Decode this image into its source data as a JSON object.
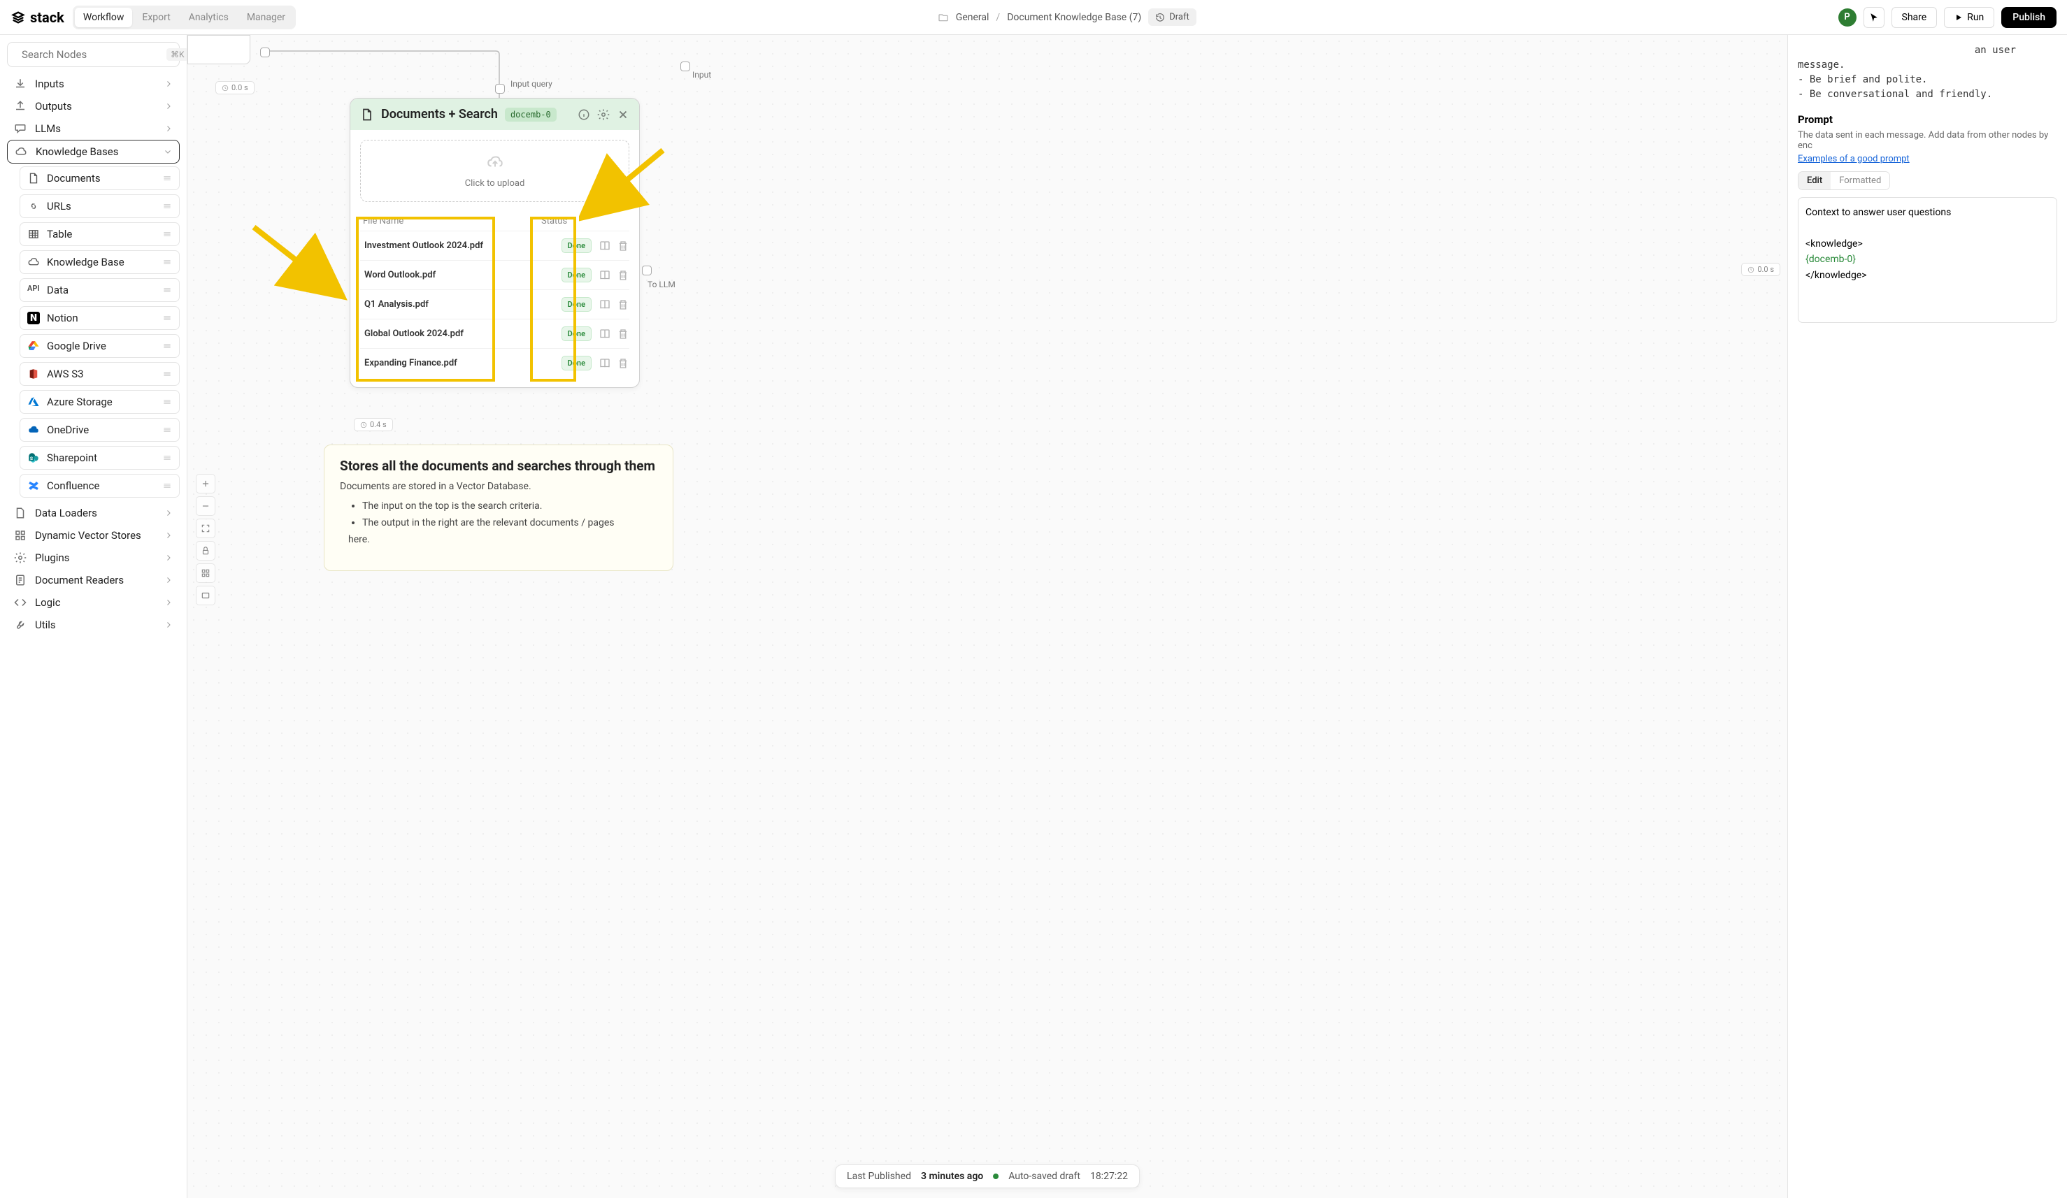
{
  "header": {
    "logo_text": "stack",
    "tabs": [
      "Workflow",
      "Export",
      "Analytics",
      "Manager"
    ],
    "active_tab": 0,
    "breadcrumb": {
      "folder": "General",
      "doc": "Document Knowledge Base (7)"
    },
    "status_badge": "Draft",
    "avatar_initial": "P",
    "share": "Share",
    "run": "Run",
    "publish": "Publish"
  },
  "sidebar": {
    "search_placeholder": "Search Nodes",
    "search_kbd": "⌘K",
    "groups": [
      {
        "label": "Inputs",
        "icon": "download"
      },
      {
        "label": "Outputs",
        "icon": "upload"
      },
      {
        "label": "LLMs",
        "icon": "chat"
      },
      {
        "label": "Knowledge Bases",
        "icon": "cloud",
        "expanded": true
      }
    ],
    "kb_items": [
      {
        "label": "Documents",
        "icon": "doc"
      },
      {
        "label": "URLs",
        "icon": "link"
      },
      {
        "label": "Table",
        "icon": "table"
      },
      {
        "label": "Knowledge Base",
        "icon": "cloud"
      },
      {
        "label": "Data",
        "icon": "api"
      },
      {
        "label": "Notion",
        "icon": "notion"
      },
      {
        "label": "Google Drive",
        "icon": "gdrive"
      },
      {
        "label": "AWS S3",
        "icon": "aws"
      },
      {
        "label": "Azure Storage",
        "icon": "azure"
      },
      {
        "label": "OneDrive",
        "icon": "onedrive"
      },
      {
        "label": "Sharepoint",
        "icon": "sharepoint"
      },
      {
        "label": "Confluence",
        "icon": "confluence"
      }
    ],
    "groups_after": [
      {
        "label": "Data Loaders",
        "icon": "doc"
      },
      {
        "label": "Dynamic Vector Stores",
        "icon": "grid"
      },
      {
        "label": "Plugins",
        "icon": "settings"
      },
      {
        "label": "Document Readers",
        "icon": "reader"
      },
      {
        "label": "Logic",
        "icon": "code"
      },
      {
        "label": "Utils",
        "icon": "wrench"
      }
    ]
  },
  "canvas": {
    "time_top": "0.0 s",
    "time_node": "0.4 s",
    "time_right": "0.0 s",
    "input_query_label": "Input query",
    "input_label": "Input",
    "to_llm_label": "To LLM"
  },
  "doc_node": {
    "title": "Documents + Search",
    "id": "docemb-0",
    "upload_text": "Click to upload",
    "table_head": {
      "name": "File Name",
      "status": "Status"
    },
    "files": [
      {
        "name": "Investment Outlook 2024.pdf",
        "status": "Done"
      },
      {
        "name": "Word Outlook.pdf",
        "status": "Done"
      },
      {
        "name": "Q1 Analysis.pdf",
        "status": "Done"
      },
      {
        "name": "Global Outlook 2024.pdf",
        "status": "Done"
      },
      {
        "name": "Expanding Finance.pdf",
        "status": "Done"
      }
    ]
  },
  "note": {
    "title": "Stores all the documents and searches through them",
    "body": "Documents are stored in a Vector Database.",
    "bullets": [
      "The input on the top is the search criteria.",
      "The output in the right are the relevant documents / pages",
      "                                              here."
    ]
  },
  "statusbar": {
    "last_published_label": "Last Published",
    "last_published_value": "3 minutes ago",
    "autosave_label": "Auto-saved draft",
    "autosave_time": "18:27:22"
  },
  "rpanel": {
    "sys_lines": "                              an user message.\n- Be brief and polite.\n- Be conversational and friendly.",
    "prompt_heading": "Prompt",
    "prompt_sub": "The data sent in each message. Add data from other nodes by enc",
    "prompt_link": "Examples of a good prompt",
    "tabs": [
      "Edit",
      "Formatted"
    ],
    "active_tab": 0,
    "prompt_text_pre": "Context to answer user questions\n\n<knowledge>\n",
    "prompt_text_var": "{docemb-0}",
    "prompt_text_post": "\n</knowledge>"
  }
}
